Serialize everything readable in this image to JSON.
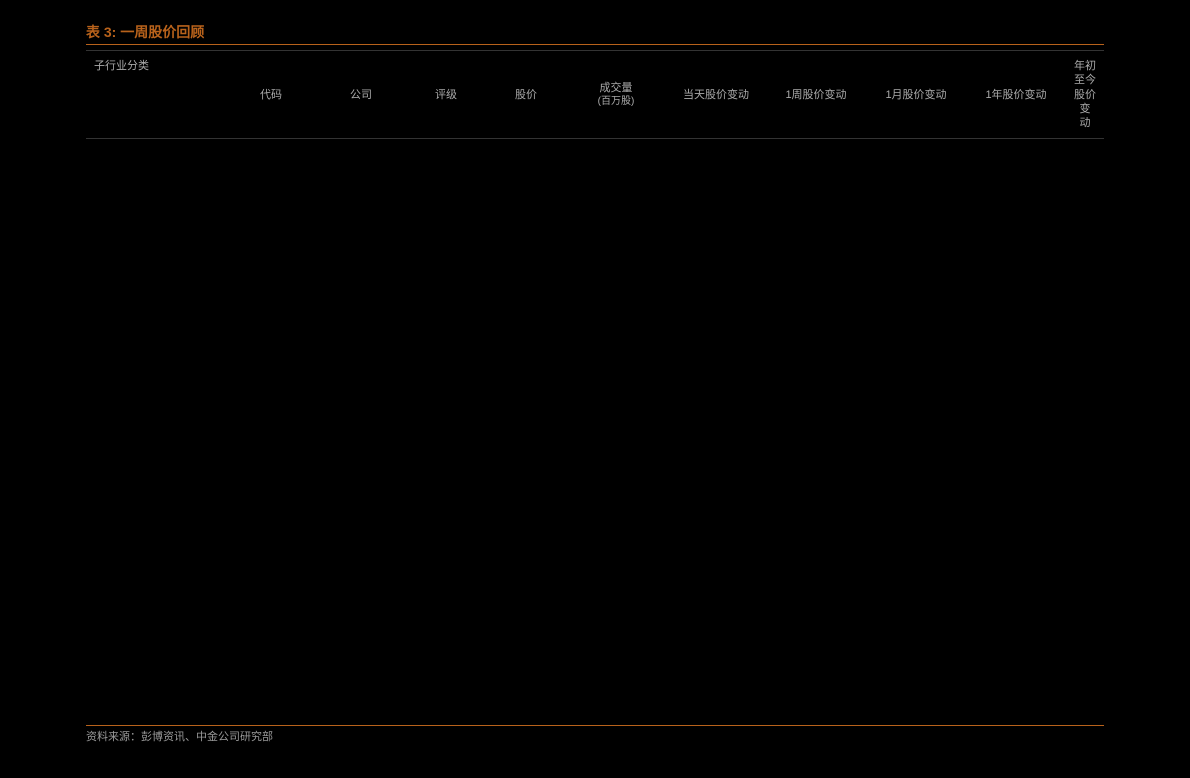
{
  "title": {
    "label": "表 3:",
    "text": "一周股价回顾"
  },
  "columns": {
    "c1": "子行业分类",
    "c2": "代码",
    "c3": "公司",
    "c4": "评级",
    "c5": "股价",
    "c6a": "成交量",
    "c6b": "(百万股)",
    "c7": "当天股价变动",
    "c8": "1周股价变动",
    "c9": "1月股价变动",
    "c10": "1年股价变动",
    "c11a": "年初至今股价变",
    "c11b": "动"
  },
  "source": "资料来源：彭博资讯、中金公司研究部"
}
